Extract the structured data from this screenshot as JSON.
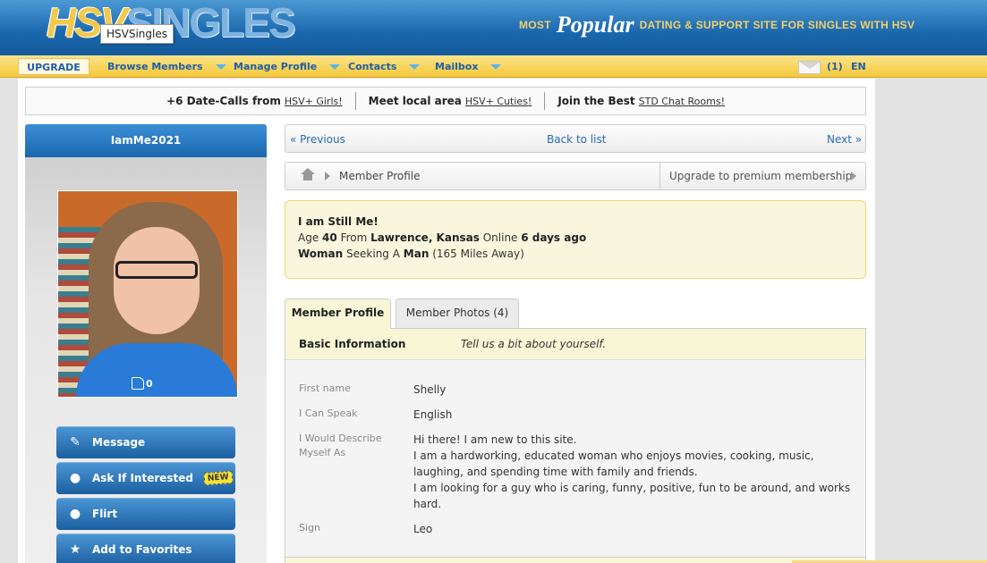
{
  "header": {
    "logo_hsv": "HSV",
    "logo_singles": "SINGLES",
    "logo_tooltip": "HSVSingles",
    "tagline_most": "MOST",
    "tagline_popular": "Popular",
    "tagline_rest": "DATING & SUPPORT SITE FOR SINGLES WITH HSV"
  },
  "nav": {
    "upgrade": "UPGRADE",
    "items": [
      {
        "label": "Browse Members"
      },
      {
        "label": "Manage Profile"
      },
      {
        "label": "Contacts"
      },
      {
        "label": "Mailbox"
      }
    ],
    "mail_count": "(1)",
    "language": "EN"
  },
  "promo": [
    {
      "bold": "+6 Date-Calls from",
      "link": "HSV+ Girls!"
    },
    {
      "bold": "Meet local area",
      "link": "HSV+ Cuties!"
    },
    {
      "bold": "Join the Best",
      "link": "STD Chat Rooms!"
    }
  ],
  "user": {
    "username": "IamMe2021",
    "likes": "0"
  },
  "actions": [
    {
      "label": "Message",
      "icon": "edit-icon"
    },
    {
      "label": "Ask If Interested",
      "icon": "lock-icon",
      "badge": "NEW"
    },
    {
      "label": "Flirt",
      "icon": "speech-bubble-icon"
    },
    {
      "label": "Add to Favorites",
      "icon": "star-icon"
    }
  ],
  "pager": {
    "previous": "« Previous",
    "back": "Back to list",
    "next": "Next »"
  },
  "breadcrumb": {
    "current": "Member Profile",
    "upgrade": "Upgrade to premium membership"
  },
  "summary": {
    "headline": "I am Still Me!",
    "age_label": "Age",
    "age": "40",
    "from_label": "From",
    "location": "Lawrence, Kansas",
    "online_label": "Online",
    "online": "6 days ago",
    "gender": "Woman",
    "seeking_label": "Seeking A",
    "seeking": "Man",
    "distance": "(165 Miles Away)"
  },
  "tabs": [
    {
      "label": "Member Profile",
      "active": true
    },
    {
      "label": "Member Photos (4)",
      "active": false
    }
  ],
  "basic_info": {
    "title": "Basic Information",
    "subtitle": "Tell us a bit about yourself.",
    "rows": [
      {
        "key": "First name",
        "value": "Shelly"
      },
      {
        "key": "I Can Speak",
        "value": "English"
      },
      {
        "key": "I Would Describe Myself As",
        "value_lines": [
          "Hi there! I am new to this site.",
          "I am a hardworking, educated woman who enjoys movies, cooking, music, laughing, and spending time with family and friends.",
          "I am looking for a guy who is caring, funny, positive, fun to be around, and works hard."
        ]
      },
      {
        "key": "Sign",
        "value": "Leo"
      }
    ]
  },
  "colors": {
    "header_blue": "#1a67ad",
    "nav_yellow": "#f5c93b",
    "link_blue": "#2a6ab0",
    "highlight_yellow": "#f9f6dd"
  }
}
